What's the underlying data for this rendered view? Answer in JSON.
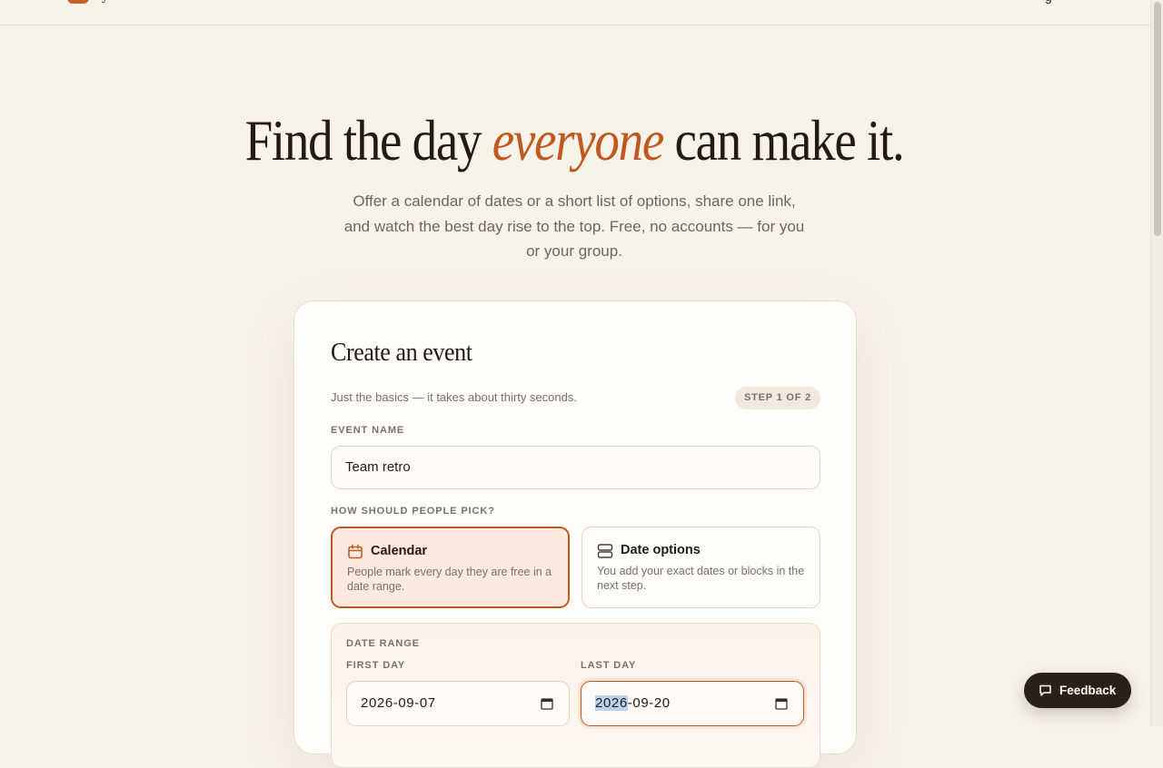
{
  "header": {
    "logo_text": "y",
    "right_link": "g"
  },
  "hero": {
    "title_before": "Find the day",
    "title_emphasis": "everyone",
    "title_after": "can make it.",
    "subtitle": "Offer a calendar of dates or a short list of options, share one link, and watch the best day rise to the top. Free, no accounts — for you or your group."
  },
  "card": {
    "title": "Create an event",
    "description": "Just the basics — it takes about thirty seconds.",
    "step_badge": "STEP 1 OF 2",
    "event_name_label": "EVENT NAME",
    "event_name_value": "Team retro",
    "pick_label": "HOW SHOULD PEOPLE PICK?",
    "options": [
      {
        "title": "Calendar",
        "description": "People mark every day they are free in a date range.",
        "icon": "calendar-icon",
        "selected": true
      },
      {
        "title": "Date options",
        "description": "You add your exact dates or blocks in the next step.",
        "icon": "stack-icon",
        "selected": false
      }
    ],
    "date_range": {
      "label": "DATE RANGE",
      "first_label": "FIRST DAY",
      "first_value": "2026-09-07",
      "last_label": "LAST DAY",
      "last_value_selected": "2026",
      "last_value_rest": "-09-20"
    }
  },
  "feedback": {
    "label": "Feedback"
  },
  "colors": {
    "accent": "#c0581f",
    "background": "#f8f3e9",
    "dark": "#2b2018"
  }
}
